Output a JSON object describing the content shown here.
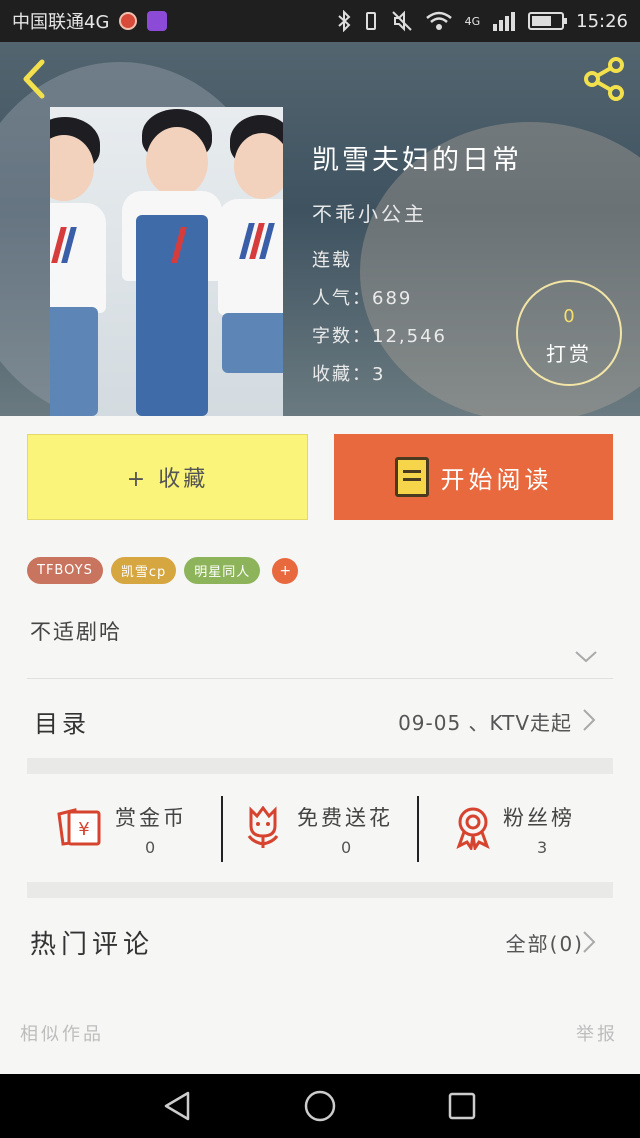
{
  "status_bar": {
    "carrier": "中国联通4G",
    "time": "15:26",
    "net": "4G"
  },
  "book": {
    "title": "凯雪夫妇的日常",
    "author": "不乖小公主",
    "status": "连载",
    "popularity": "人气：689",
    "word_count": "字数：12,546",
    "favorites": "收藏：3",
    "tip_count": "0",
    "tip_label": "打赏"
  },
  "actions": {
    "favorite_label": "+ 收藏",
    "read_label": "开始阅读"
  },
  "tags": [
    {
      "label": "TFBOYS",
      "color": "#c8745e"
    },
    {
      "label": "凯雪cp",
      "color": "#d6a640"
    },
    {
      "label": "明星同人",
      "color": "#8db45a"
    }
  ],
  "tag_add": "+",
  "description": "不适剧哈",
  "toc": {
    "label": "目录",
    "latest": "09-05 、KTV走起"
  },
  "stats": [
    {
      "label": "赏金币",
      "value": "0",
      "icon": "coin-envelope-icon"
    },
    {
      "label": "免费送花",
      "value": "0",
      "icon": "flower-icon"
    },
    {
      "label": "粉丝榜",
      "value": "3",
      "icon": "medal-icon"
    }
  ],
  "comments": {
    "label": "热门评论",
    "all": "全部(0)"
  },
  "footer": {
    "similar": "相似作品",
    "report": "举报"
  },
  "colors": {
    "accent_orange": "#e8693e",
    "favorite_yellow": "#faf47a",
    "icon_red": "#d6432e"
  }
}
